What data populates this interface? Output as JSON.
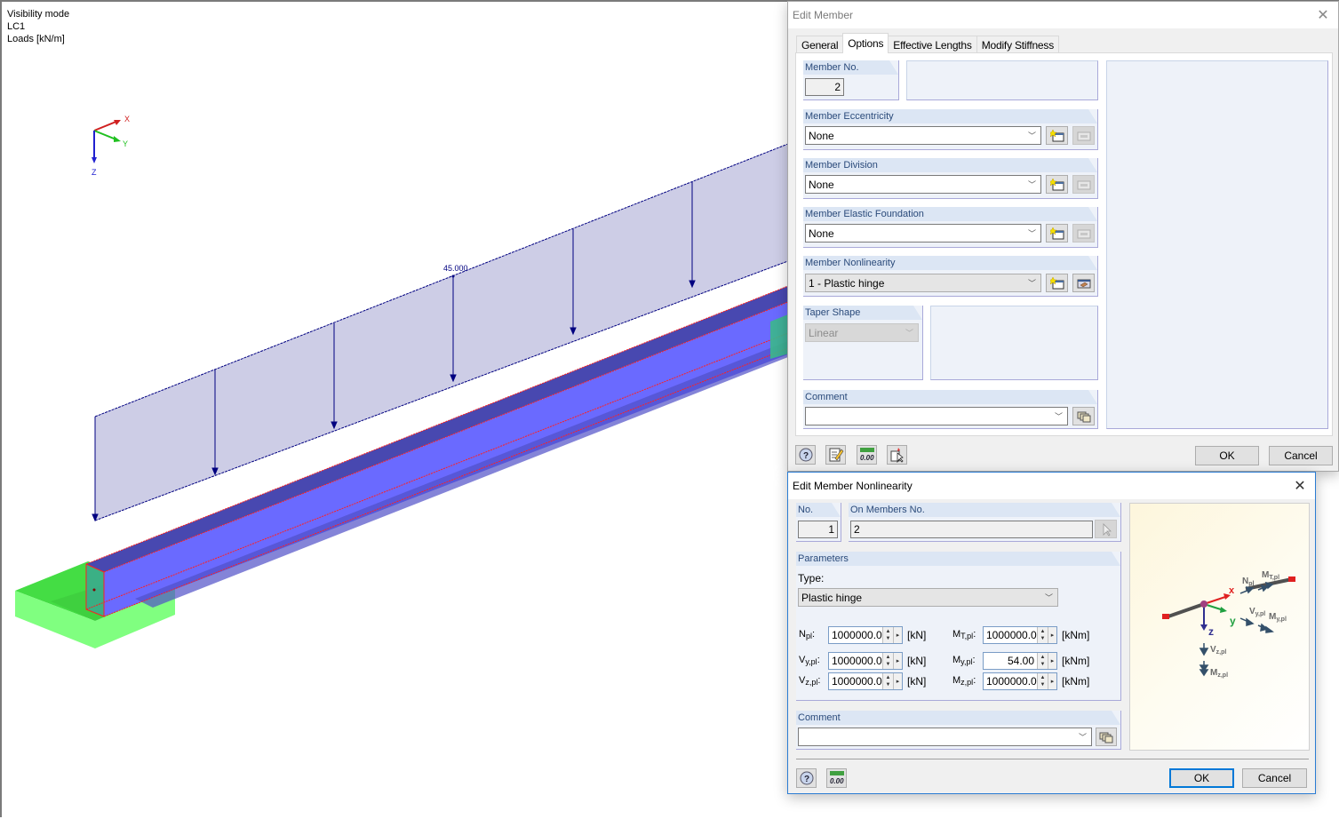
{
  "viewport": {
    "info_lines": [
      "Visibility mode",
      "LC1",
      "Loads [kN/m]"
    ],
    "axes": {
      "x": "X",
      "y": "Y",
      "z": "Z"
    },
    "load_label": "45.000",
    "colors": {
      "load_fill": "#cdcde6",
      "load_line": "#000080",
      "member_top": "#4848b0",
      "member_side": "#6a6aff",
      "member_edge": "#ff2020",
      "support": "#80ff80",
      "axis_x": "#d02020",
      "axis_y": "#20c020",
      "axis_z": "#2020d0"
    }
  },
  "edit_member": {
    "title": "Edit Member",
    "close_icon": "close-icon",
    "tabs": [
      {
        "label": "General",
        "active": false
      },
      {
        "label": "Options",
        "active": true
      },
      {
        "label": "Effective Lengths",
        "active": false
      },
      {
        "label": "Modify Stiffness",
        "active": false
      }
    ],
    "member_no": {
      "label": "Member No.",
      "value": "2"
    },
    "eccentricity": {
      "label": "Member Eccentricity",
      "value": "None"
    },
    "division": {
      "label": "Member Division",
      "value": "None"
    },
    "elastic_foundation": {
      "label": "Member Elastic Foundation",
      "value": "None"
    },
    "nonlinearity": {
      "label": "Member Nonlinearity",
      "value": "1 - Plastic hinge"
    },
    "taper_shape": {
      "label": "Taper Shape",
      "value": "Linear"
    },
    "comment": {
      "label": "Comment",
      "value": ""
    },
    "footer_icons": [
      "help-icon",
      "edit-icon",
      "units-icon",
      "select-icon"
    ],
    "ok_label": "OK",
    "cancel_label": "Cancel"
  },
  "edit_nonlinearity": {
    "title": "Edit Member Nonlinearity",
    "no": {
      "label": "No.",
      "value": "1"
    },
    "on_members": {
      "label": "On Members No.",
      "value": "2"
    },
    "parameters": {
      "label": "Parameters",
      "type_label": "Type:",
      "type_value": "Plastic hinge",
      "rows": [
        {
          "left": {
            "sym": "N",
            "sub": "pl",
            "value": "1000000.00",
            "unit": "[kN]"
          },
          "right": {
            "sym": "M",
            "sub": "T,pl",
            "value": "1000000.00",
            "unit": "[kNm]"
          }
        },
        {
          "left": {
            "sym": "V",
            "sub": "y,pl",
            "value": "1000000.00",
            "unit": "[kN]"
          },
          "right": {
            "sym": "M",
            "sub": "y,pl",
            "value": "54.00",
            "unit": "[kNm]"
          }
        },
        {
          "left": {
            "sym": "V",
            "sub": "z,pl",
            "value": "1000000.00",
            "unit": "[kN]"
          },
          "right": {
            "sym": "M",
            "sub": "z,pl",
            "value": "1000000.00",
            "unit": "[kNm]"
          }
        }
      ]
    },
    "diagram": {
      "labels": {
        "x": "x",
        "y": "y",
        "z": "z",
        "npl": "N",
        "npl_sub": "pl",
        "mtpl": "M",
        "mtpl_sub": "T,pl",
        "vypl": "V",
        "vypl_sub": "y,pl",
        "mypl": "M",
        "mypl_sub": "y,pl",
        "vzpl": "V",
        "vzpl_sub": "z,pl",
        "mzpl": "M",
        "mzpl_sub": "z,pl"
      }
    },
    "comment": {
      "label": "Comment",
      "value": ""
    },
    "footer_icons": [
      "help-icon",
      "units-icon"
    ],
    "ok_label": "OK",
    "cancel_label": "Cancel"
  }
}
